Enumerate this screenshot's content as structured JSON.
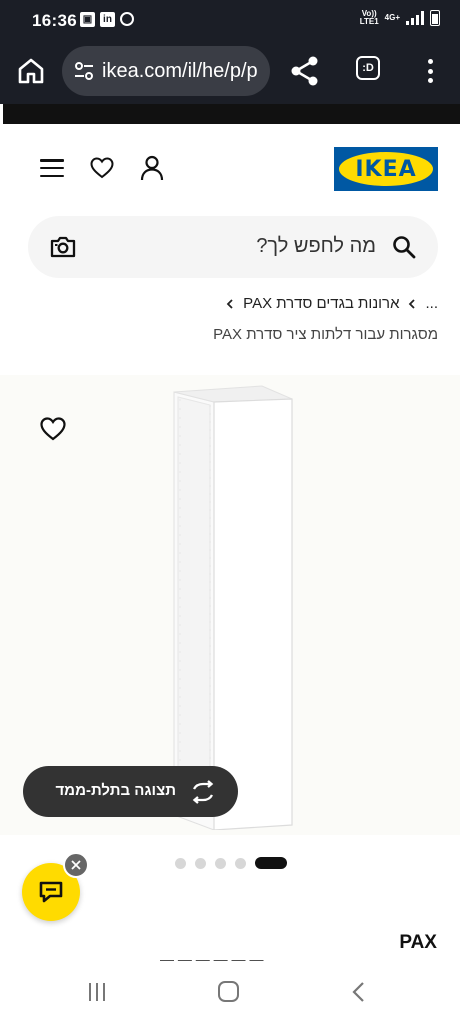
{
  "status_bar": {
    "time": "16:36",
    "left_icons": [
      "image-icon",
      "linkedin-icon",
      "sync-icon"
    ],
    "network_line1": "Vo))",
    "network_line2": "LTE1",
    "network_type": "4G+"
  },
  "browser": {
    "url": "ikea.com/il/he/p/p",
    "tab_label": ":D"
  },
  "header": {
    "logo_text": "IKEA",
    "brand_colors": {
      "blue": "#0058a3",
      "yellow": "#ffdb00"
    }
  },
  "search": {
    "placeholder": "מה לחפש לך?"
  },
  "breadcrumb": {
    "ellipsis": "...",
    "item": "ארונות בגדים סדרת PAX"
  },
  "subtitle": "מסגרות עבור דלתות ציר סדרת PAX",
  "product": {
    "view_3d_label": "תצוגה בתלת-ממד",
    "name": "PAX",
    "carousel": {
      "total": 5,
      "active": 1
    }
  }
}
